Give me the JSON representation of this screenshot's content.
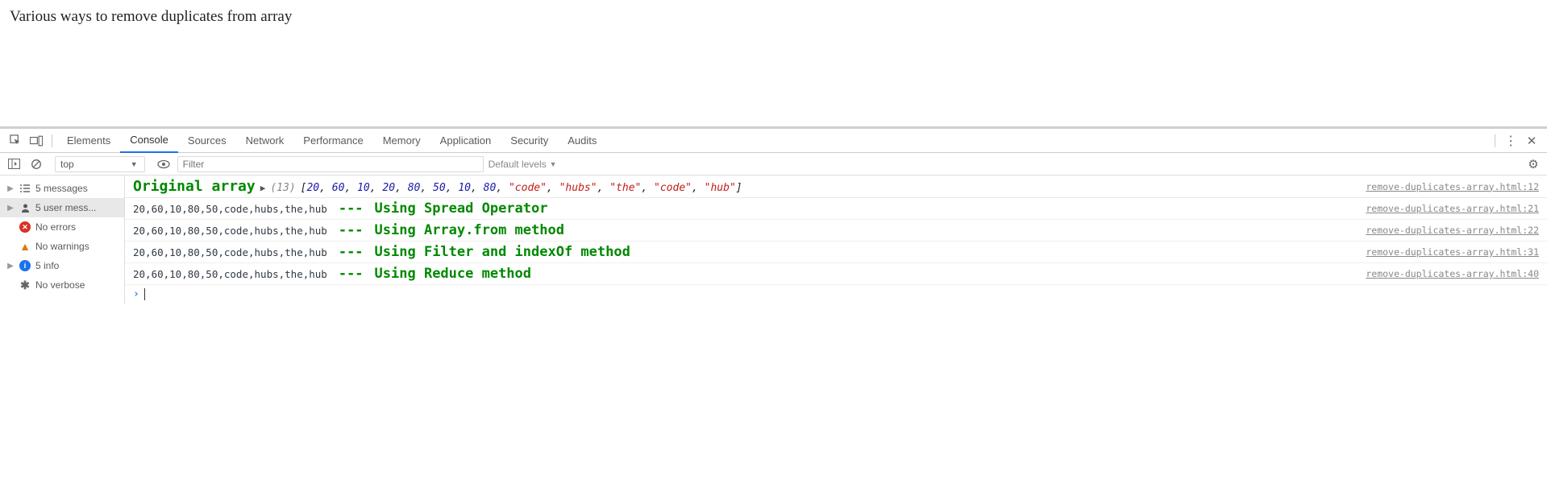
{
  "page": {
    "title": "Various ways to remove duplicates from array"
  },
  "devtools": {
    "tabs": [
      "Elements",
      "Console",
      "Sources",
      "Network",
      "Performance",
      "Memory",
      "Application",
      "Security",
      "Audits"
    ],
    "active_tab": "Console",
    "filterbar": {
      "context": "top",
      "filter_placeholder": "Filter",
      "levels": "Default levels"
    },
    "sidebar": {
      "items": [
        {
          "label": "5 messages",
          "icon": "list",
          "expandable": true,
          "selected": false
        },
        {
          "label": "5 user mess...",
          "icon": "user",
          "expandable": true,
          "selected": true
        },
        {
          "label": "No errors",
          "icon": "error",
          "expandable": false,
          "selected": false
        },
        {
          "label": "No warnings",
          "icon": "warning",
          "expandable": false,
          "selected": false
        },
        {
          "label": "5 info",
          "icon": "info",
          "expandable": true,
          "selected": false
        },
        {
          "label": "No verbose",
          "icon": "debug",
          "expandable": false,
          "selected": false
        }
      ]
    },
    "messages": [
      {
        "type": "styled-array",
        "label": "Original array",
        "length": "(13)",
        "array_numbers": [
          "20",
          "60",
          "10",
          "20",
          "80",
          "50",
          "10",
          "80"
        ],
        "array_strings": [
          "\"code\"",
          "\"hubs\"",
          "\"the\"",
          "\"code\"",
          "\"hub\""
        ],
        "source": "remove-duplicates-array.html:12"
      },
      {
        "type": "method",
        "values": "20,60,10,80,50,code,hubs,the,hub",
        "method": "Using Spread Operator",
        "source": "remove-duplicates-array.html:21"
      },
      {
        "type": "method",
        "values": "20,60,10,80,50,code,hubs,the,hub",
        "method": "Using Array.from method",
        "source": "remove-duplicates-array.html:22"
      },
      {
        "type": "method",
        "values": "20,60,10,80,50,code,hubs,the,hub",
        "method": "Using Filter and indexOf method",
        "source": "remove-duplicates-array.html:31"
      },
      {
        "type": "method",
        "values": "20,60,10,80,50,code,hubs,the,hub",
        "method": "Using Reduce method",
        "source": "remove-duplicates-array.html:40"
      }
    ]
  }
}
